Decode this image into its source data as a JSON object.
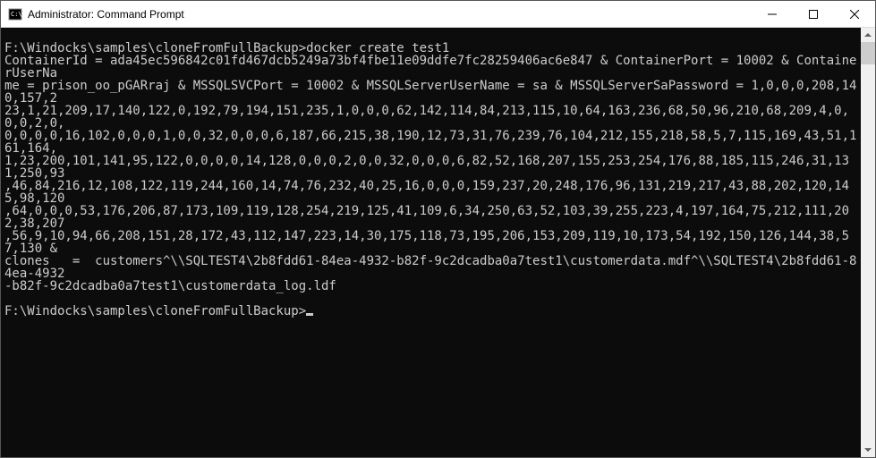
{
  "window": {
    "title": "Administrator: Command Prompt"
  },
  "terminal": {
    "prompt": "F:\\Windocks\\samples\\cloneFromFullBackup>",
    "command1": "docker create test1",
    "output_segments": {
      "l1": "ContainerId = ada45ec596842c01fd467dcb5249a73bf4fbe11e09ddfe7fc28259406ac6e847 & ContainerPort = 10002 & ContainerUserNa",
      "l2": "me = prison_oo_pGARraj & MSSQLSVCPort = 10002 & MSSQLServerUserName = sa & MSSQLServerSaPassword = 1,0,0,0,208,140,157,2",
      "l3": "23,1,21,209,17,140,122,0,192,79,194,151,235,1,0,0,0,62,142,114,84,213,115,10,64,163,236,68,50,96,210,68,209,4,0,0,0,2,0,",
      "l4": "0,0,0,0,16,102,0,0,0,1,0,0,32,0,0,0,6,187,66,215,38,190,12,73,31,76,239,76,104,212,155,218,58,5,7,115,169,43,51,161,164,",
      "l5": "1,23,200,101,141,95,122,0,0,0,0,14,128,0,0,0,2,0,0,32,0,0,0,6,82,52,168,207,155,253,254,176,88,185,115,246,31,131,250,93",
      "l6": ",46,84,216,12,108,122,119,244,160,14,74,76,232,40,25,16,0,0,0,159,237,20,248,176,96,131,219,217,43,88,202,120,145,98,120",
      "l7": ",64,0,0,0,53,176,206,87,173,109,119,128,254,219,125,41,109,6,34,250,63,52,103,39,255,223,4,197,164,75,212,111,202,38,207",
      "l8": ",56,9,10,94,66,208,151,28,172,43,112,147,223,14,30,175,118,73,195,206,153,209,119,10,173,54,192,150,126,144,38,57,130 & ",
      "l9a": "clones   =  customers^\\\\SQLTEST4\\2b8fdd61-84ea-4932-b82f-9c2dcadba0a7test1\\customerdata.mdf^\\\\SQLTEST4\\2b8fdd61-84ea-4932",
      "l10": "-b82f-9c2dcadba0a7test1\\customerdata_log.ldf"
    }
  }
}
